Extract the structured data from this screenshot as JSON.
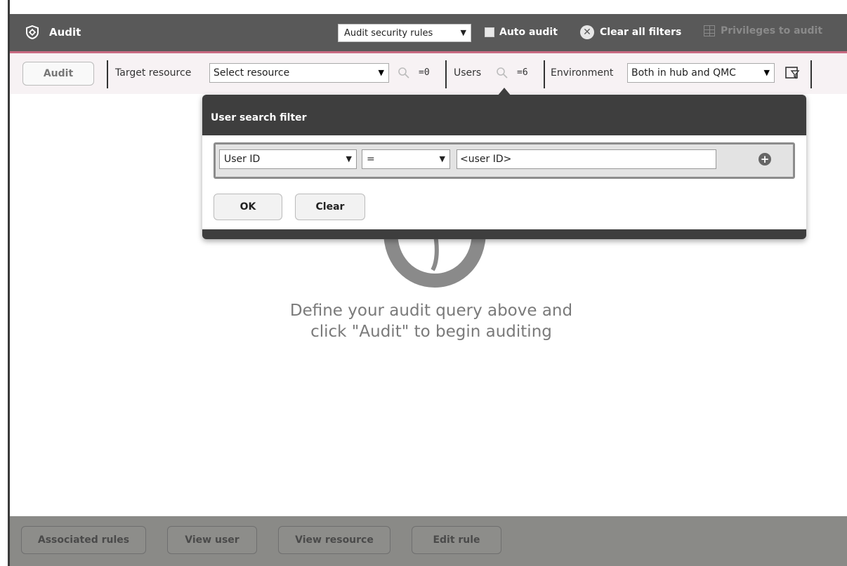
{
  "header": {
    "title": "Audit",
    "audit_type": "Audit security rules",
    "auto_audit": "Auto audit",
    "clear_filters": "Clear all filters",
    "privileges": "Privileges to audit"
  },
  "filters": {
    "audit_button": "Audit",
    "target_label": "Target resource",
    "target_value": "Select resource",
    "target_count": "=0",
    "users_label": "Users",
    "users_count": "=6",
    "env_label": "Environment",
    "env_value": "Both in hub and QMC"
  },
  "popup": {
    "title": "User search filter",
    "field_value": "User ID",
    "operator_value": "=",
    "input_value": "<user ID>",
    "ok_label": "OK",
    "clear_label": "Clear"
  },
  "main": {
    "message_line1": "Define your audit query above and",
    "message_line2": "click \"Audit\" to begin auditing"
  },
  "footer": {
    "associated_rules": "Associated rules",
    "view_user": "View user",
    "view_resource": "View resource",
    "edit_rule": "Edit rule"
  },
  "colors": {
    "header_bg": "#595959",
    "accent": "#c86a82",
    "filter_bg": "#f7f2f4",
    "footer_bg": "#8a8a87"
  }
}
